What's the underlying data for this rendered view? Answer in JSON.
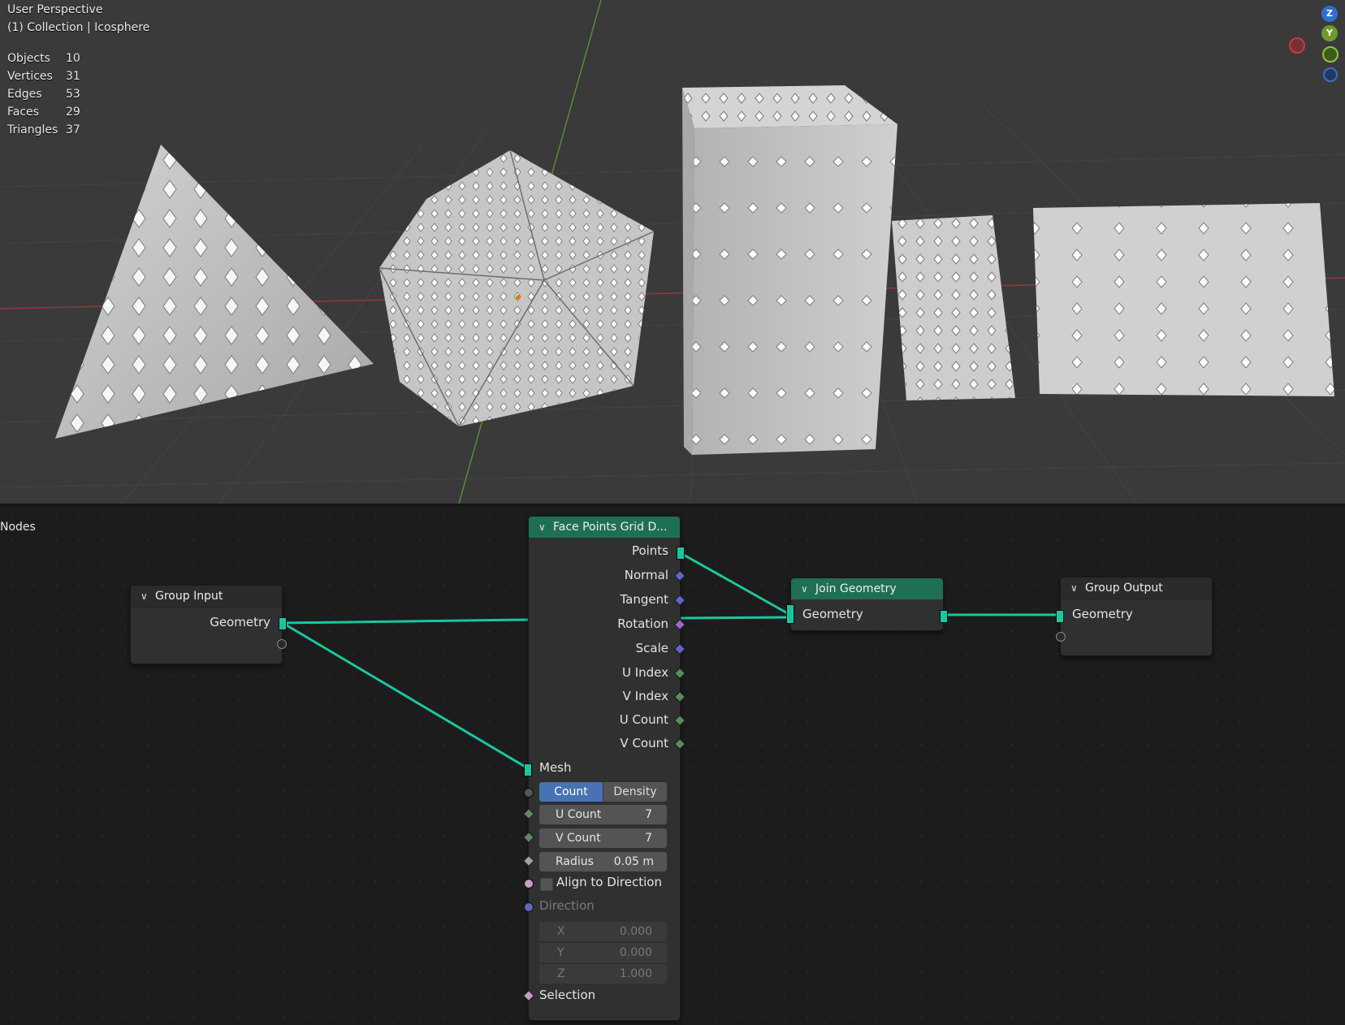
{
  "viewport": {
    "view_name": "User Perspective",
    "collection_info": "(1) Collection | Icosphere",
    "stats": [
      {
        "label": "Objects",
        "value": "10"
      },
      {
        "label": "Vertices",
        "value": "31"
      },
      {
        "label": "Edges",
        "value": "53"
      },
      {
        "label": "Faces",
        "value": "29"
      },
      {
        "label": "Triangles",
        "value": "37"
      }
    ],
    "gizmo": {
      "z": "Z",
      "y": "Y"
    }
  },
  "editor": {
    "title": "Nodes"
  },
  "nodes": {
    "group_input": {
      "title": "Group Input",
      "outputs": [
        "Geometry"
      ]
    },
    "face_points": {
      "title": "Face Points Grid D...",
      "outputs": [
        "Points",
        "Normal",
        "Tangent",
        "Rotation",
        "Scale",
        "U Index",
        "V Index",
        "U Count",
        "V Count"
      ],
      "mesh_input": "Mesh",
      "mode_options": [
        "Count",
        "Density"
      ],
      "mode_selected": "Count",
      "u_count": {
        "label": "U Count",
        "value": "7"
      },
      "v_count": {
        "label": "V Count",
        "value": "7"
      },
      "radius": {
        "label": "Radius",
        "value": "0.05 m"
      },
      "align_label": "Align to Direction",
      "direction_label": "Direction",
      "direction": [
        {
          "label": "X",
          "value": "0.000"
        },
        {
          "label": "Y",
          "value": "0.000"
        },
        {
          "label": "Z",
          "value": "1.000"
        }
      ],
      "selection_label": "Selection"
    },
    "join_geometry": {
      "title": "Join Geometry",
      "input": "Geometry"
    },
    "group_output": {
      "title": "Group Output",
      "input": "Geometry"
    }
  },
  "colors": {
    "geometry_socket": "#18c7a0",
    "node_header_green": "#1f6f57",
    "vector_socket": "#6363c7",
    "int_socket": "#598c5c",
    "rotation_socket": "#a363c7",
    "bool_socket": "#cc99cc",
    "count_selected": "#4772b3"
  }
}
